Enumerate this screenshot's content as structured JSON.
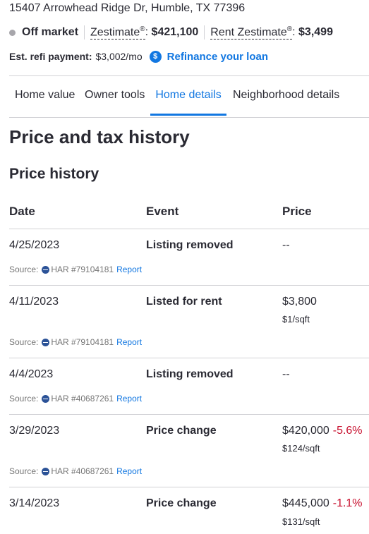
{
  "address": "15407 Arrowhead Ridge Dr, Humble, TX 77396",
  "status": {
    "market_label": "Off market",
    "zestimate_label": "Zestimate",
    "zestimate_reg": "®",
    "zestimate_value": "$421,100",
    "rent_label": "Rent Zestimate",
    "rent_reg": "®",
    "rent_value": "$3,499"
  },
  "refi": {
    "label": "Est. refi payment:",
    "value": "$3,002/mo",
    "icon": "$",
    "link": "Refinance your loan"
  },
  "tabs": [
    {
      "label": "Home value"
    },
    {
      "label": "Owner tools"
    },
    {
      "label": "Home details",
      "active": true
    },
    {
      "label": "Neighborhood details"
    }
  ],
  "section_title": "Price and tax history",
  "subsection_title": "Price history",
  "table": {
    "headers": {
      "date": "Date",
      "event": "Event",
      "price": "Price"
    },
    "rows": [
      {
        "date": "4/25/2023",
        "event": "Listing removed",
        "price": "--",
        "change": "",
        "sqft": "",
        "source_label": "Source:",
        "source": "HAR #79104181",
        "report": "Report"
      },
      {
        "date": "4/11/2023",
        "event": "Listed for rent",
        "price": "$3,800",
        "change": "",
        "sqft": "$1/sqft",
        "source_label": "Source:",
        "source": "HAR #79104181",
        "report": "Report"
      },
      {
        "date": "4/4/2023",
        "event": "Listing removed",
        "price": "--",
        "change": "",
        "sqft": "",
        "source_label": "Source:",
        "source": "HAR #40687261",
        "report": "Report"
      },
      {
        "date": "3/29/2023",
        "event": "Price change",
        "price": "$420,000",
        "change": "-5.6%",
        "sqft": "$124/sqft",
        "source_label": "Source:",
        "source": "HAR #40687261",
        "report": "Report"
      },
      {
        "date": "3/14/2023",
        "event": "Price change",
        "price": "$445,000",
        "change": "-1.1%",
        "sqft": "$131/sqft"
      }
    ]
  },
  "colors": {
    "accent": "#1277e1",
    "negative": "#c8102e",
    "muted": "#767676"
  }
}
